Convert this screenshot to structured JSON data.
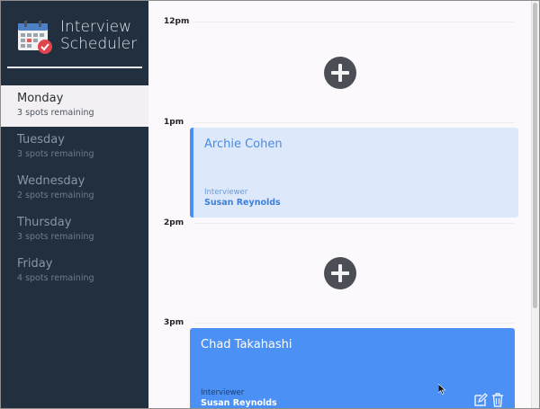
{
  "app": {
    "title_line1": "Interview",
    "title_line2": "Scheduler"
  },
  "sidebar": {
    "days": [
      {
        "name": "Monday",
        "spots": "3 spots remaining",
        "selected": true
      },
      {
        "name": "Tuesday",
        "spots": "3 spots remaining"
      },
      {
        "name": "Wednesday",
        "spots": "2 spots remaining"
      },
      {
        "name": "Thursday",
        "spots": "3 spots remaining"
      },
      {
        "name": "Friday",
        "spots": "4 spots remaining"
      }
    ]
  },
  "schedule": {
    "times": [
      "12pm",
      "1pm",
      "2pm",
      "3pm"
    ],
    "appointments": [
      {
        "student": "Archie Cohen",
        "interviewer_label": "Interviewer",
        "interviewer": "Susan Reynolds"
      },
      {
        "student": "Chad Takahashi",
        "interviewer_label": "Interviewer",
        "interviewer": "Susan Reynolds"
      }
    ]
  },
  "icons": {
    "logo": "calendar-check-icon",
    "add": "plus-icon",
    "edit": "edit-icon",
    "delete": "trash-icon"
  },
  "colors": {
    "sidebar_bg": "#222f3e",
    "accent_blue": "#4a90f5",
    "light_card": "#dde9fb",
    "add_button": "#4b4e54"
  }
}
